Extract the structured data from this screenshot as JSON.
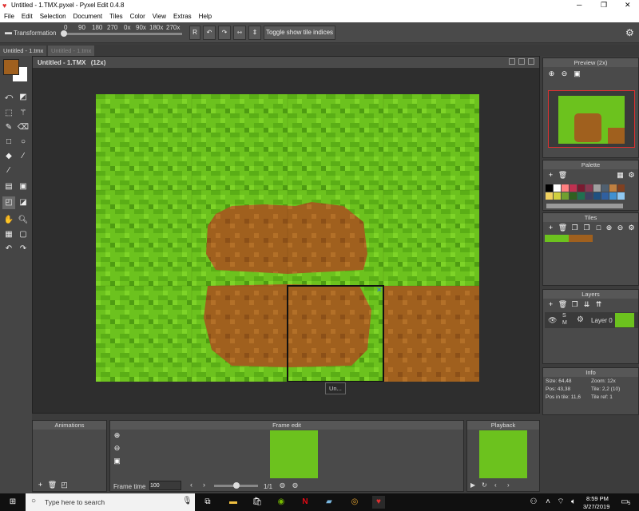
{
  "window": {
    "title": "Untitled - 1.TMX.pyxel - Pyxel Edit 0.4.8"
  },
  "menu": [
    "File",
    "Edit",
    "Selection",
    "Document",
    "Tiles",
    "Color",
    "View",
    "Extras",
    "Help"
  ],
  "toolbar": {
    "transformation_label": "Transformation",
    "rotations": [
      "0",
      "90",
      "180",
      "270",
      "0x",
      "90x",
      "180x",
      "270x"
    ],
    "r_label": "R",
    "toggle_label": "Toggle show tile indices"
  },
  "tabs": [
    "Untitled - 1.tmx",
    "Untitled - 1.tmx"
  ],
  "document": {
    "title": "Untitled - 1.TMX",
    "zoom": "(12x)",
    "tooltip": "Un..."
  },
  "panels": {
    "preview": "Preview (2x)",
    "palette": "Palette",
    "tiles": "Tiles",
    "layers": "Layers",
    "layer_name": "Layer 0",
    "info": "Info",
    "animations": "Animations",
    "frame_edit": "Frame edit",
    "playback": "Playback"
  },
  "info": {
    "size": "Size: 64,48",
    "zoom": "Zoom: 12x",
    "pos": "Pos: 43,38",
    "tile": "Tile: 2,2 (10)",
    "pos_in_tile": "Pos in tile: 11,6",
    "tile_ref": "Tile ref: 1"
  },
  "frame": {
    "label": "Frame time",
    "value": "100",
    "counter": "1/1"
  },
  "taskbar": {
    "search_placeholder": "Type here to search",
    "time": "8:59 PM",
    "date": "3/27/2019",
    "notif": "5"
  },
  "colors": {
    "grass": "#6cc21e",
    "dirt": "#a0601e",
    "accent": "#e03030"
  },
  "palette_colors": [
    "#000000",
    "#ffffff",
    "#ff8080",
    "#c03050",
    "#7a1a30",
    "#883850",
    "#a0a0a0",
    "#506070",
    "#c08040",
    "#804020",
    "#f0d060",
    "#d0d040",
    "#70a030",
    "#306020",
    "#207050",
    "#404060",
    "#205080",
    "#3060a0",
    "#4090d0",
    "#90c8f0"
  ],
  "tiles": [
    "grass-tile",
    "dirt-tile"
  ]
}
